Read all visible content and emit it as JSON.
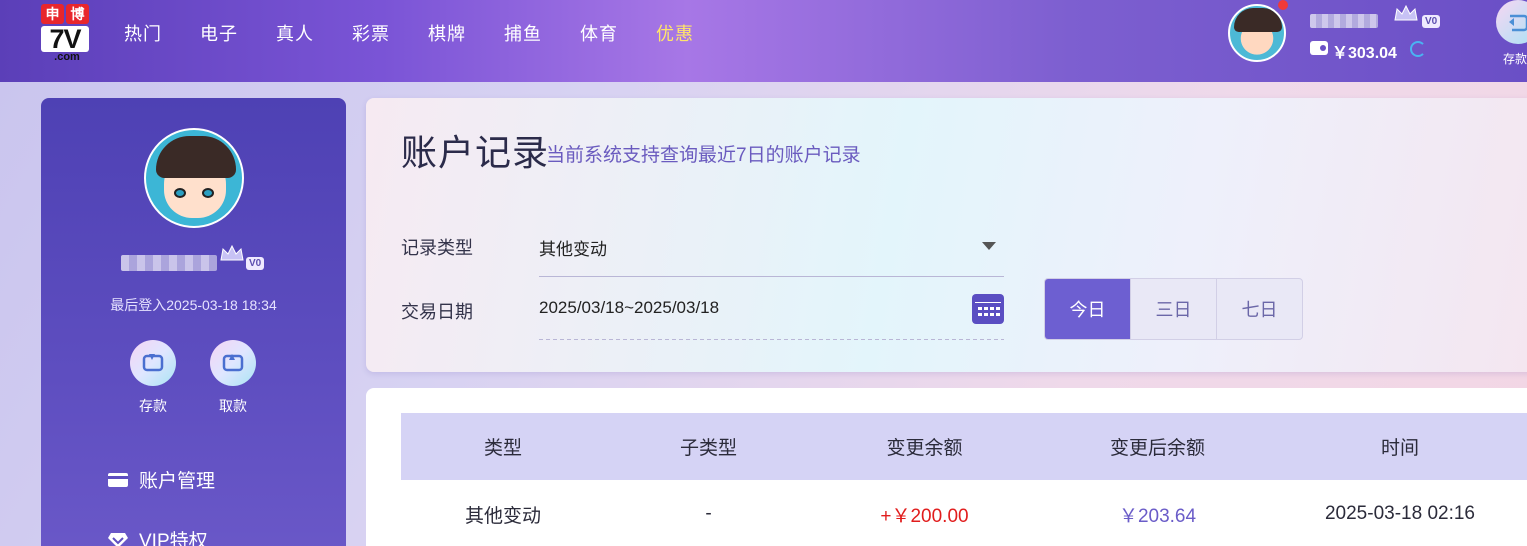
{
  "brand": {
    "top_chars": [
      "申",
      "博"
    ],
    "big": "7V",
    "domain": ".com"
  },
  "nav": [
    {
      "label": "热门"
    },
    {
      "label": "电子"
    },
    {
      "label": "真人"
    },
    {
      "label": "彩票"
    },
    {
      "label": "棋牌"
    },
    {
      "label": "捕鱼"
    },
    {
      "label": "体育"
    },
    {
      "label": "优惠"
    }
  ],
  "user": {
    "vip_level": "V0",
    "balance": "￥303.04",
    "last_login": "最后登入2025-03-18 18:34"
  },
  "top_actions": {
    "deposit_label": "存款"
  },
  "sidebar": {
    "quick_actions": [
      {
        "label": "存款"
      },
      {
        "label": "取款"
      }
    ],
    "menu": [
      {
        "label": "账户管理"
      },
      {
        "label": "VIP特权"
      }
    ]
  },
  "filter": {
    "title": "账户记录",
    "subtitle": "当前系统支持查询最近7日的账户记录",
    "record_type_label": "记录类型",
    "record_type_value": "其他变动",
    "date_label": "交易日期",
    "date_value": "2025/03/18~2025/03/18",
    "ranges": [
      {
        "label": "今日",
        "active": true
      },
      {
        "label": "三日"
      },
      {
        "label": "七日"
      }
    ]
  },
  "table": {
    "headers": [
      "类型",
      "子类型",
      "变更余额",
      "变更后余额",
      "时间"
    ],
    "rows": [
      {
        "type": "其他变动",
        "subtype": "-",
        "change": "+￥200.00",
        "after": "￥203.64",
        "time": "2025-03-18 02:16"
      }
    ]
  },
  "colors": {
    "accent": "#6d5fd1",
    "positive": "#e11d1d",
    "promo": "#ffe46b"
  }
}
